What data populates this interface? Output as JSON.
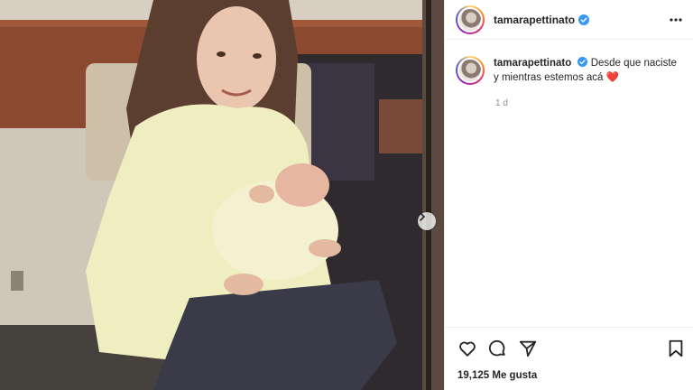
{
  "post": {
    "username": "tamarapettinato",
    "caption_username": "tamarapettinato",
    "caption_text": "Desde que naciste y mientras estemos acá",
    "caption_emoji": "❤️",
    "time": "1 d",
    "likes": "19,125 Me gusta"
  },
  "icons": {
    "verified": "verified-badge-icon",
    "more": "more-options-icon",
    "like": "heart-icon",
    "comment": "comment-icon",
    "share": "share-icon",
    "save": "bookmark-icon",
    "next": "chevron-right-icon"
  },
  "colors": {
    "verified": "#3897f0",
    "heart": "#ed4956",
    "muted": "#8e8e8e"
  }
}
